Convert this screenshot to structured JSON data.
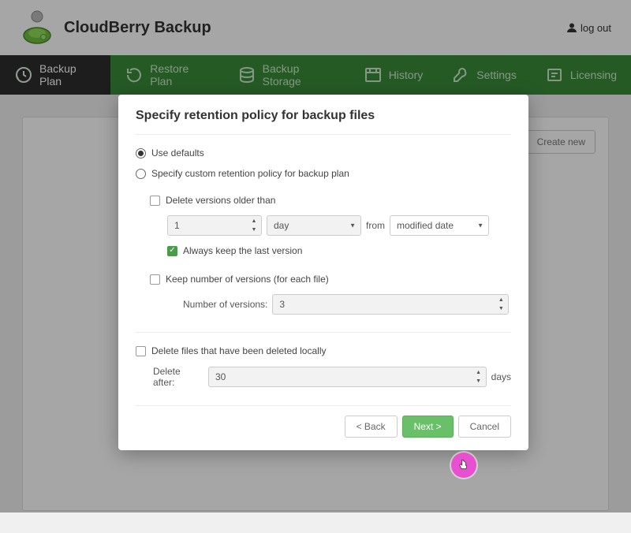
{
  "header": {
    "brand": "CloudBerry Backup",
    "logout": "log out"
  },
  "nav": {
    "items": [
      {
        "label": "Backup Plan"
      },
      {
        "label": "Restore Plan"
      },
      {
        "label": "Backup Storage"
      },
      {
        "label": "History"
      },
      {
        "label": "Settings"
      },
      {
        "label": "Licensing"
      }
    ]
  },
  "panel": {
    "create_new": "Create new"
  },
  "modal": {
    "title": "Specify retention policy for backup files",
    "use_defaults": "Use defaults",
    "specify_custom": "Specify custom retention policy for backup plan",
    "delete_older": "Delete versions older than",
    "older_value": "1",
    "older_unit": "day",
    "from_label": "from",
    "from_value": "modified date",
    "always_keep": "Always keep the last version",
    "keep_number": "Keep number of versions (for each file)",
    "num_versions_label": "Number of versions:",
    "num_versions_value": "3",
    "delete_local": "Delete files that have been deleted locally",
    "delete_after_label": "Delete after:",
    "delete_after_value": "30",
    "days_label": "days",
    "back": "< Back",
    "next": "Next >",
    "cancel": "Cancel"
  }
}
